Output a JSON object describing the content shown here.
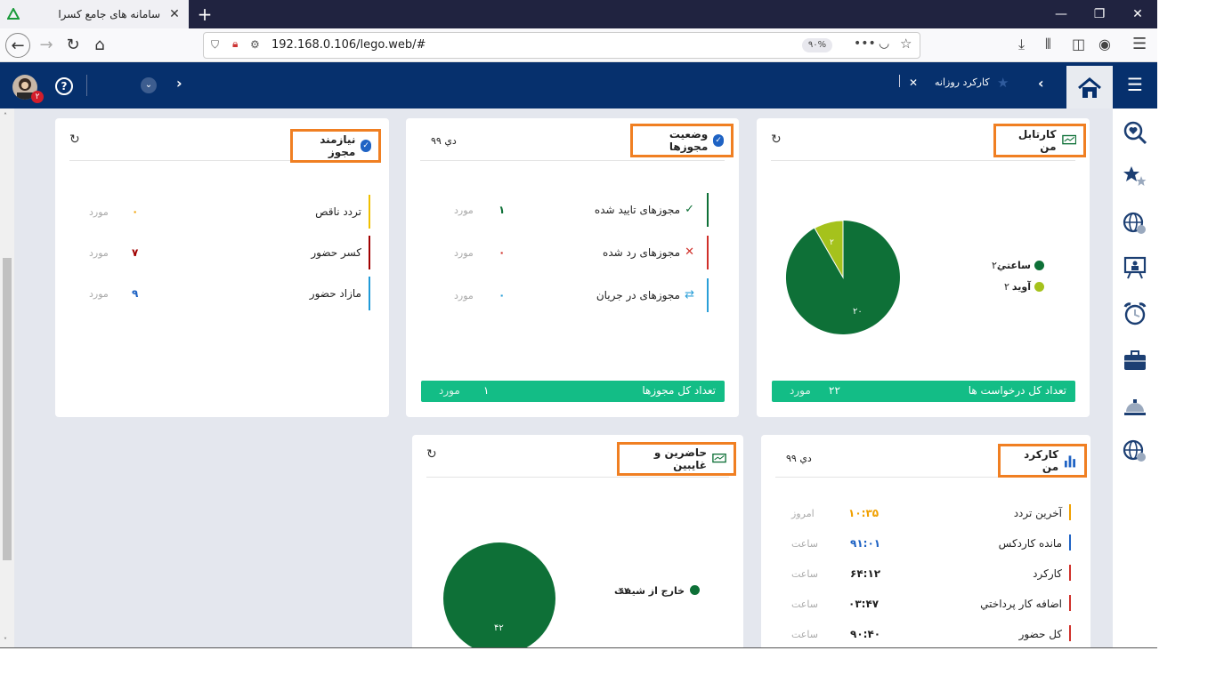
{
  "browser": {
    "tab_title": "سامانه های جامع کسرا",
    "url": "192.168.0.106/lego.web/#",
    "zoom": "۹۰%"
  },
  "header": {
    "open_tab": "کارکرد روزانه",
    "notification_count": "۲"
  },
  "cards": {
    "kartabl": {
      "title": "کارتابل من",
      "legend": [
        {
          "label": "ساعتي",
          "value": "۲۰",
          "color": "#0e7037"
        },
        {
          "label": "آويد",
          "value": "۲",
          "color": "#a5c21c"
        }
      ],
      "pie_labels": {
        "big": "۲۰",
        "small": "۲"
      },
      "footer_label": "تعداد کل درخواست ها",
      "footer_value": "۲۲",
      "footer_unit": "مورد"
    },
    "mojavez_status": {
      "title": "وضعیت مجوزها",
      "date": "دي ۹۹",
      "rows": [
        {
          "label": "مجوزهای تایید شده",
          "value": "۱",
          "unit": "مورد",
          "color": "#0e7037"
        },
        {
          "label": "مجوزهای رد شده",
          "value": "۰",
          "unit": "مورد",
          "color": "#d0302a"
        },
        {
          "label": "مجوزهای در جریان",
          "value": "۰",
          "unit": "مورد",
          "color": "#2a9fd8"
        }
      ],
      "footer_label": "تعداد کل مجوزها",
      "footer_value": "۱",
      "footer_unit": "مورد"
    },
    "niazmand": {
      "title": "نیازمند مجوز",
      "rows": [
        {
          "label": "تردد ناقص",
          "value": "۰",
          "unit": "مورد",
          "color": "#f0a000",
          "barcolor": "#f0c000"
        },
        {
          "label": "کسر حضور",
          "value": "۷",
          "unit": "مورد",
          "color": "#a00000",
          "barcolor": "#a00000"
        },
        {
          "label": "مازاد حضور",
          "value": "۹",
          "unit": "مورد",
          "color": "#1f63c4",
          "barcolor": "#1f9ad8"
        }
      ]
    },
    "karkard": {
      "title": "کارکرد من",
      "date": "دي ۹۹",
      "rows": [
        {
          "label": "آخرين تردد",
          "value": "۱۰:۳۵",
          "unit": "امروز",
          "color": "#f0a000",
          "barcolor": "#f0a000"
        },
        {
          "label": "مانده کاردکس",
          "value": "۹۱:۰۱",
          "unit": "ساعت",
          "color": "#1f63c4",
          "barcolor": "#1f63c4"
        },
        {
          "label": "کارکرد",
          "value": "۶۴:۱۲",
          "unit": "ساعت",
          "color": "#222",
          "barcolor": "#d0302a"
        },
        {
          "label": "اضافه کار پرداختي",
          "value": "۰۳:۴۷",
          "unit": "ساعت",
          "color": "#222",
          "barcolor": "#d0302a"
        },
        {
          "label": "کل حضور",
          "value": "۹۰:۴۰",
          "unit": "ساعت",
          "color": "#222",
          "barcolor": "#d0302a"
        }
      ]
    },
    "hazerin": {
      "title": "حاضرين و غايبين",
      "legend": [
        {
          "label": "خارج از شيفت",
          "value": "۴۲",
          "color": "#0e7037"
        }
      ],
      "pie_label": "۴۲"
    }
  }
}
